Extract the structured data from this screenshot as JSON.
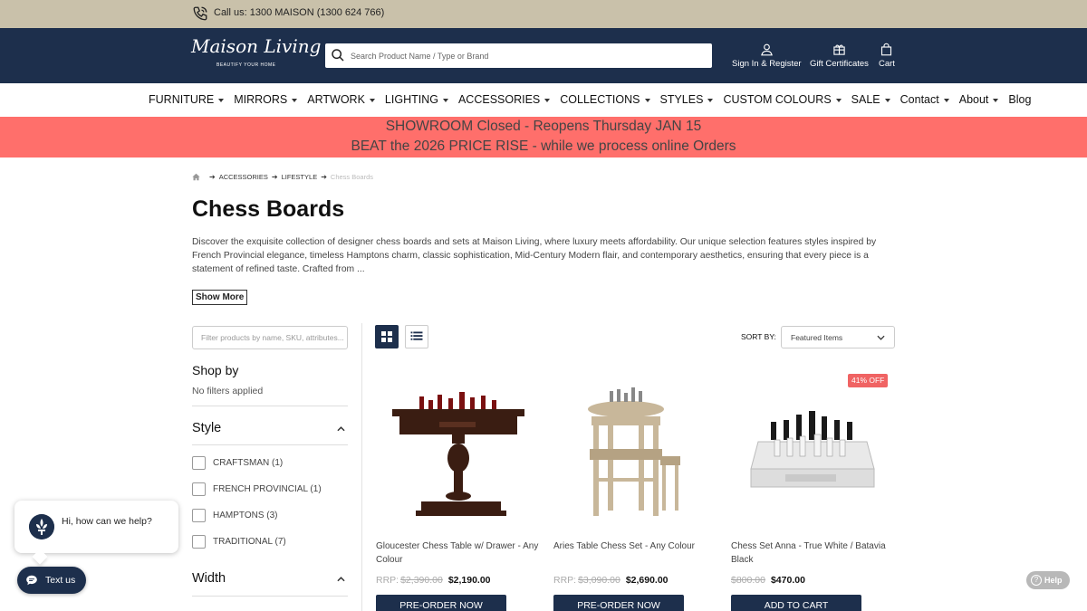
{
  "topbar": {
    "call_text": "Call us: 1300 MAISON (1300 624 766)"
  },
  "header": {
    "logo_text": "Maison Living",
    "logo_tagline": "BEAUTIFY  YOUR HOME",
    "search_placeholder": "Search Product Name / Type or Brand",
    "sign_in": "Sign In & Register",
    "gift": "Gift Certificates",
    "cart": "Cart"
  },
  "nav": {
    "items": [
      {
        "label": "FURNITURE",
        "dropdown": true
      },
      {
        "label": "MIRRORS",
        "dropdown": true
      },
      {
        "label": "ARTWORK",
        "dropdown": true
      },
      {
        "label": "LIGHTING",
        "dropdown": true
      },
      {
        "label": "ACCESSORIES",
        "dropdown": true
      },
      {
        "label": "COLLECTIONS",
        "dropdown": true
      },
      {
        "label": "STYLES",
        "dropdown": true
      },
      {
        "label": "CUSTOM COLOURS",
        "dropdown": true
      },
      {
        "label": "SALE",
        "dropdown": true
      },
      {
        "label": "Contact",
        "dropdown": true
      },
      {
        "label": "About",
        "dropdown": true
      },
      {
        "label": "Blog",
        "dropdown": false
      }
    ]
  },
  "banner": {
    "line1": "SHOWROOM Closed - Reopens Thursday JAN 15",
    "line2": "BEAT the 2026 PRICE RISE - while we process online Orders",
    "color": "#ff6f6b"
  },
  "breadcrumb": {
    "items": [
      "ACCESSORIES",
      "LIFESTYLE"
    ],
    "current": "Chess Boards"
  },
  "page": {
    "title": "Chess Boards",
    "description": "Discover the exquisite collection of designer chess boards and sets at Maison Living, where luxury meets affordability. Our unique selection features styles inspired by French Provincial elegance, timeless Hamptons charm, classic sophistication, Mid-Century Modern flair, and contemporary aesthetics, ensuring that every piece is a statement of refined taste. Crafted from ...",
    "show_more": "Show More"
  },
  "sidebar": {
    "filter_placeholder": "Filter products by name, SKU, attributes...",
    "shop_by": "Shop by",
    "no_filters": "No filters applied",
    "style_heading": "Style",
    "style_options": [
      "CRAFTSMAN (1)",
      "FRENCH PROVINCIAL (1)",
      "HAMPTONS (3)",
      "TRADITIONAL (7)"
    ],
    "width_heading": "Width"
  },
  "toolbar": {
    "sort_label": "SORT BY:",
    "sort_value": "Featured Items"
  },
  "products": [
    {
      "name": "Gloucester Chess Table w/ Drawer - Any Colour",
      "rrp_label": "RRP:",
      "rrp": "$2,390.00",
      "price": "$2,190.00",
      "button": "PRE-ORDER NOW"
    },
    {
      "name": "Aries Table Chess Set - Any Colour",
      "rrp_label": "RRP:",
      "rrp": "$3,090.00",
      "price": "$2,690.00",
      "button": "PRE-ORDER NOW"
    },
    {
      "name": "Chess Set Anna - True White / Batavia Black",
      "rrp_label": "",
      "rrp": "$800.00",
      "price": "$470.00",
      "button": "ADD TO CART",
      "badge": "41% OFF"
    }
  ],
  "chat": {
    "greeting": "Hi, how can we help?",
    "text_us": "Text us",
    "help": "Help"
  },
  "colors": {
    "navy": "#1d2f4c",
    "topbar": "#c9c1aa",
    "badge": "#f06363"
  }
}
